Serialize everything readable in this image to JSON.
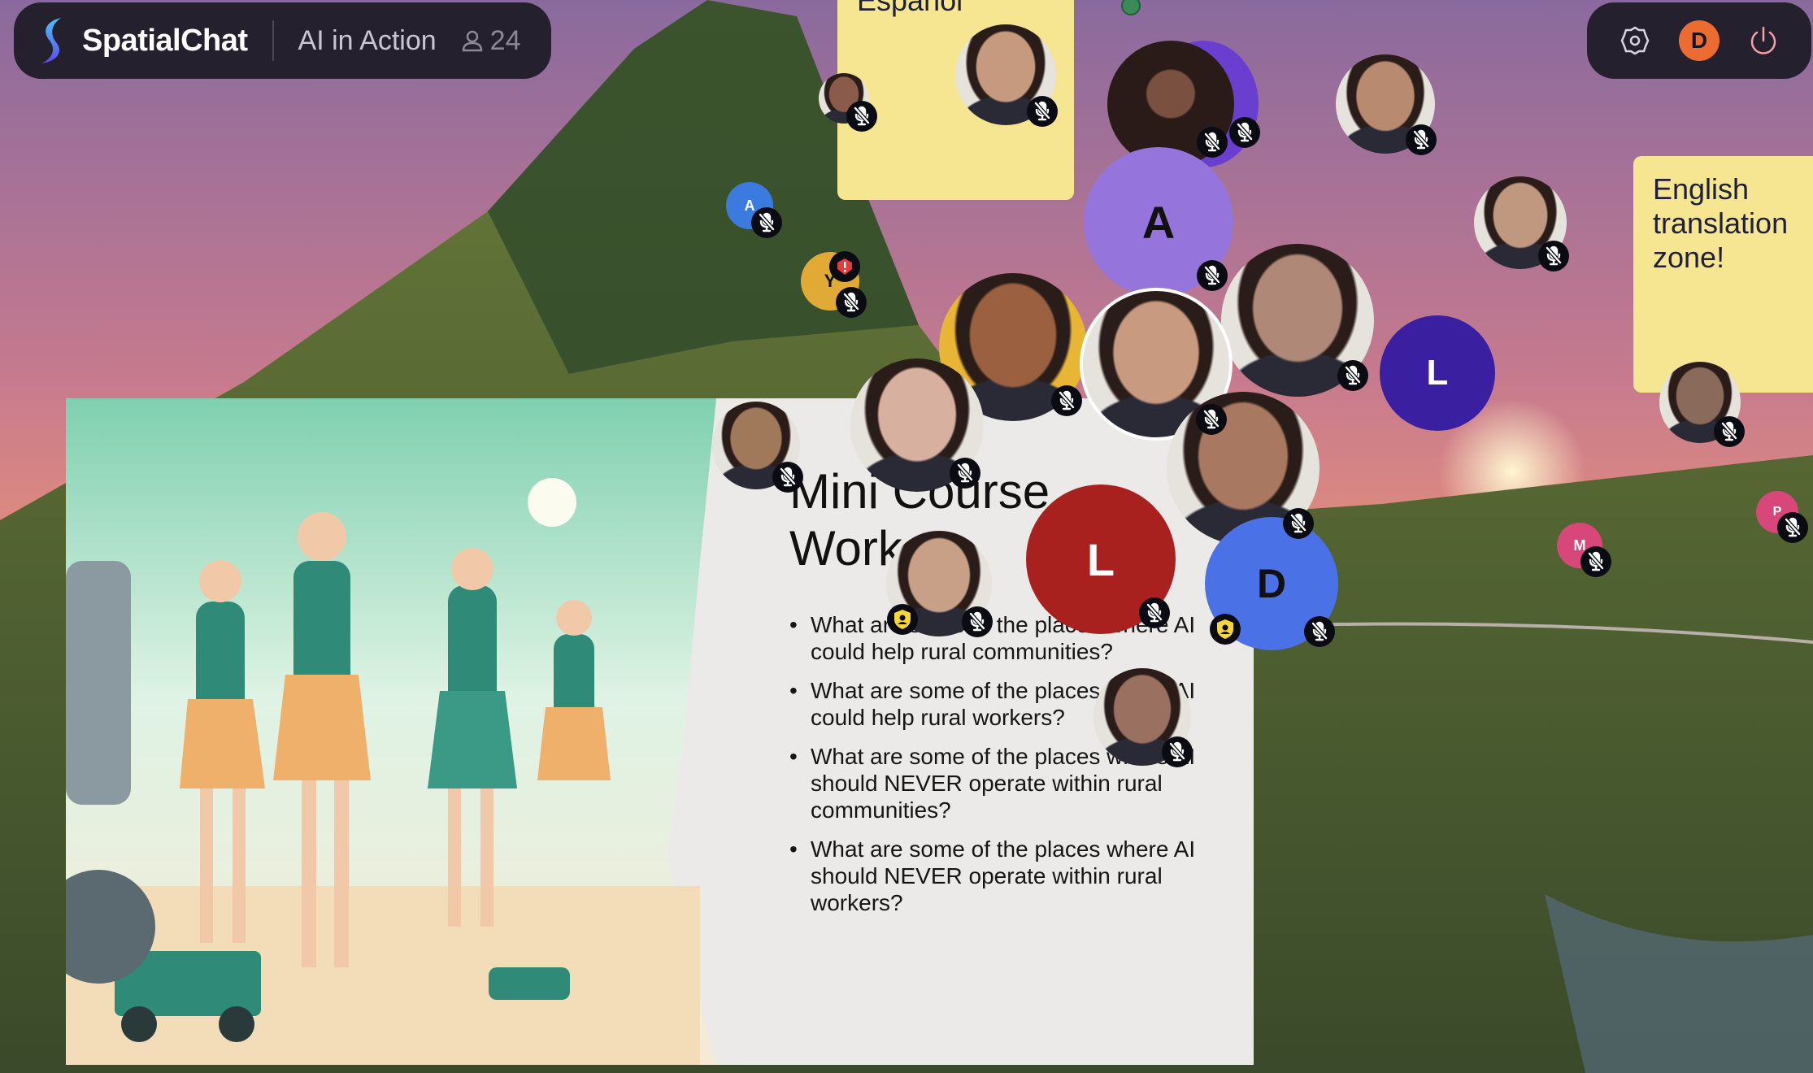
{
  "app": {
    "name": "SpatialChat",
    "room": "AI in Action",
    "participant_count": "24"
  },
  "controls": {
    "settings": "gear-icon",
    "user_initial": "D",
    "user_color": "#ec6b30",
    "leave": "power-icon"
  },
  "notes": {
    "spanish": "Español",
    "english": "English translation zone!"
  },
  "slide": {
    "title_line1": "Mini Course",
    "title_line2": "Work",
    "bullets": [
      "What are some of the places where AI could help rural communities?",
      "What are some of the places where AI could help rural workers?",
      "What are some of the places where AI should NEVER operate within rural communities?",
      "What are some of the places where AI should NEVER operate within rural workers?"
    ]
  },
  "participants": [
    {
      "initial": "A",
      "color": "#3b7be0"
    },
    {
      "initial": "Y",
      "color": "#e0aa35"
    },
    {
      "initial": "A",
      "color": "#9575db"
    },
    {
      "initial": "L",
      "color": "#3a1fa0"
    },
    {
      "initial": "L",
      "color": "#a8211f"
    },
    {
      "initial": "D",
      "color": "#4a72e6"
    },
    {
      "initial": "M",
      "color": "#d8477a"
    },
    {
      "initial": "P",
      "color": "#d8477a"
    }
  ]
}
